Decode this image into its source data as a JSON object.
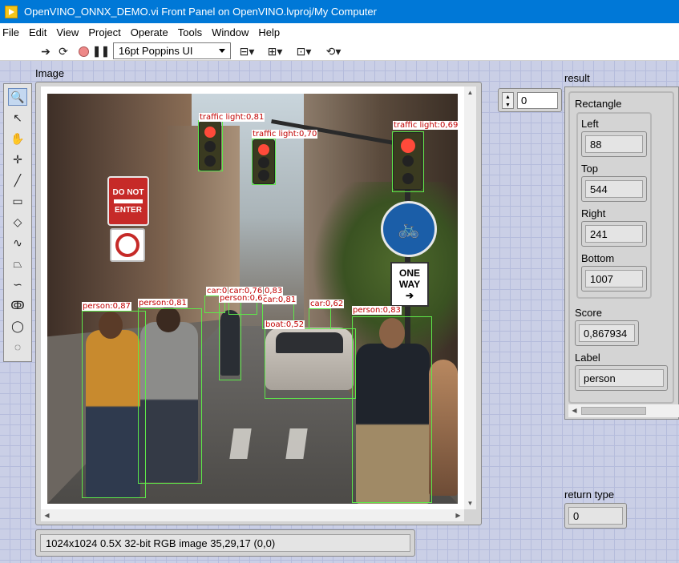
{
  "window": {
    "title": "OpenVINO_ONNX_DEMO.vi Front Panel on OpenVINO.lvproj/My Computer"
  },
  "menu": [
    "File",
    "Edit",
    "View",
    "Project",
    "Operate",
    "Tools",
    "Window",
    "Help"
  ],
  "toolbar": {
    "font_select": "16pt Poppins UI"
  },
  "image_display": {
    "label": "Image",
    "status": "1024x1024 0.5X 32-bit RGB image 35,29,17    (0,0)",
    "detections": [
      {
        "label": "traffic light:0,81"
      },
      {
        "label": "traffic light:0,70"
      },
      {
        "label": "traffic light:0,69"
      },
      {
        "label": "car:0"
      },
      {
        "label": "car:0,76"
      },
      {
        "label": "0,83"
      },
      {
        "label": "person:0,65"
      },
      {
        "label": "car:0,81"
      },
      {
        "label": "car:0,62"
      },
      {
        "label": "boat:0,52"
      },
      {
        "label": "person:0,87"
      },
      {
        "label": "person:0,81"
      },
      {
        "label": "person:0,83"
      }
    ],
    "signs": {
      "do_not": "DO NOT",
      "enter": "ENTER",
      "one": "ONE",
      "way": "WAY"
    }
  },
  "index_control": {
    "value": "0"
  },
  "result": {
    "label": "result",
    "rectangle_label": "Rectangle",
    "left_label": "Left",
    "left": "88",
    "top_label": "Top",
    "top": "544",
    "right_label": "Right",
    "right": "241",
    "bottom_label": "Bottom",
    "bottom": "1007",
    "score_label": "Score",
    "score": "0,867934",
    "label_label": "Label",
    "label_value": "person"
  },
  "return_type": {
    "label": "return type",
    "value": "0"
  }
}
